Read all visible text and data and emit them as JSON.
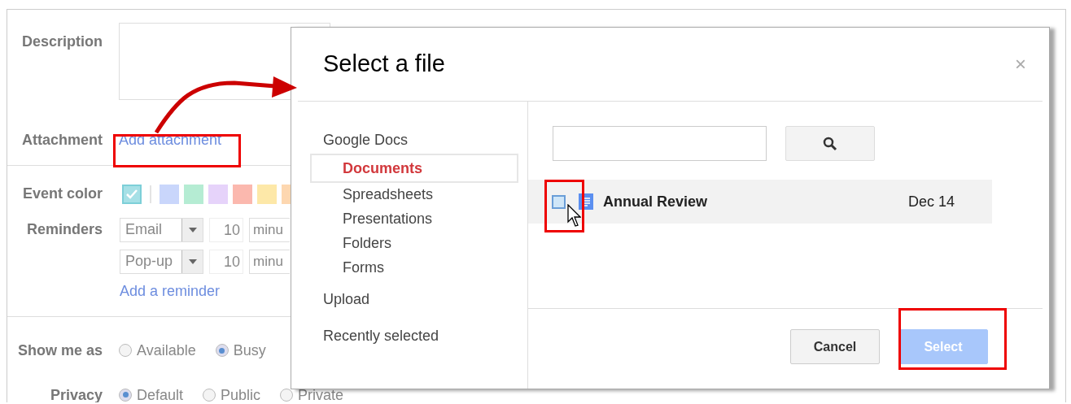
{
  "form": {
    "description": {
      "label": "Description"
    },
    "attachment": {
      "label": "Attachment",
      "link": "Add attachment"
    },
    "event_color": {
      "label": "Event color",
      "swatches": [
        {
          "color": "#a6e0e6",
          "selected": true
        },
        {
          "color": "#c9d6fb",
          "selected": false
        },
        {
          "color": "#b5ecd3",
          "selected": false
        },
        {
          "color": "#e6d3fa",
          "selected": false
        },
        {
          "color": "#fbb8ae",
          "selected": false
        },
        {
          "color": "#fde8a8",
          "selected": false
        },
        {
          "color": "#fdd7b0",
          "selected": false
        }
      ]
    },
    "reminders": {
      "label": "Reminders",
      "items": [
        {
          "method": "Email",
          "value": "10",
          "unit": "minu"
        },
        {
          "method": "Pop-up",
          "value": "10",
          "unit": "minu"
        }
      ],
      "add_link": "Add a reminder"
    },
    "show_me_as": {
      "label": "Show me as",
      "options": [
        {
          "label": "Available",
          "selected": false
        },
        {
          "label": "Busy",
          "selected": true
        }
      ]
    },
    "privacy": {
      "label": "Privacy",
      "options": [
        {
          "label": "Default",
          "selected": true
        },
        {
          "label": "Public",
          "selected": false
        },
        {
          "label": "Private",
          "selected": false
        }
      ]
    }
  },
  "dialog": {
    "title": "Select a file",
    "close": "×",
    "nav": {
      "heading": "Google Docs",
      "items": [
        {
          "label": "Documents",
          "selected": true
        },
        {
          "label": "Spreadsheets",
          "selected": false
        },
        {
          "label": "Presentations",
          "selected": false
        },
        {
          "label": "Folders",
          "selected": false
        },
        {
          "label": "Forms",
          "selected": false
        }
      ],
      "links": [
        "Upload",
        "Recently selected"
      ]
    },
    "files": [
      {
        "name": "Annual Review",
        "date": "Dec 14",
        "checked": false
      }
    ],
    "buttons": [
      {
        "label": "Cancel",
        "disabled": false,
        "kind": "secondary"
      },
      {
        "label": "Select",
        "disabled": true,
        "kind": "primary"
      }
    ]
  }
}
